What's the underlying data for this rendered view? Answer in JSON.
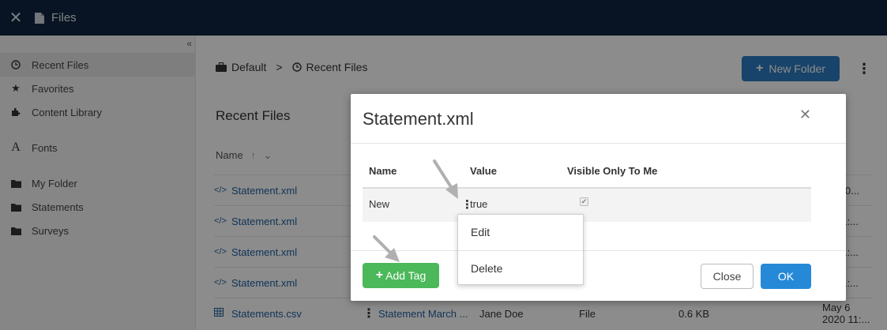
{
  "topbar": {
    "close_icon": "close-icon",
    "file_icon": "file-icon",
    "title": "Files"
  },
  "sidebar": {
    "collapse_label": "«",
    "items": [
      {
        "label": "Recent Files",
        "icon": "clock-icon",
        "active": true
      },
      {
        "label": "Favorites",
        "icon": "star-icon"
      },
      {
        "label": "Content Library",
        "icon": "puzzle-icon"
      },
      {
        "label": "Fonts",
        "icon": "font-icon"
      },
      {
        "label": "My Folder",
        "icon": "folder-icon"
      },
      {
        "label": "Statements",
        "icon": "folder-icon"
      },
      {
        "label": "Surveys",
        "icon": "folder-icon"
      }
    ]
  },
  "main": {
    "breadcrumb": {
      "root": "Default",
      "separator": ">",
      "current": "Recent Files"
    },
    "new_folder_label": "New Folder",
    "page_title": "Recent Files",
    "columns": {
      "name": "Name",
      "modified_partial": "ified"
    },
    "rows": [
      {
        "name": "Statement.xml",
        "icon": "code-icon",
        "modified": "20 2:0..."
      },
      {
        "name": "Statement.xml",
        "icon": "code-icon",
        "modified": "20 11:..."
      },
      {
        "name": "Statement.xml",
        "icon": "code-icon",
        "modified": "20 11:..."
      },
      {
        "name": "Statement.xml",
        "icon": "code-icon",
        "modified": "20 11:..."
      },
      {
        "name": "Statements.csv",
        "icon": "table-icon",
        "description": "Statement March ...",
        "owner": "Jane Doe",
        "type": "File",
        "size": "0.6 KB",
        "modified": "May 6 2020 11:..."
      }
    ]
  },
  "dialog": {
    "title": "Statement.xml",
    "close_icon": "close-icon",
    "headers": {
      "name": "Name",
      "value": "Value",
      "visible": "Visible Only To Me"
    },
    "tag": {
      "name": "New",
      "value": "true",
      "visible_only_to_me": true
    },
    "add_tag_label": "Add Tag",
    "close_label": "Close",
    "ok_label": "OK"
  },
  "context_menu": {
    "edit_label": "Edit",
    "delete_label": "Delete"
  },
  "colors": {
    "topbar": "#0f2540",
    "primary": "#2589d8",
    "success": "#4bb85a",
    "link": "#1f5f9f"
  }
}
